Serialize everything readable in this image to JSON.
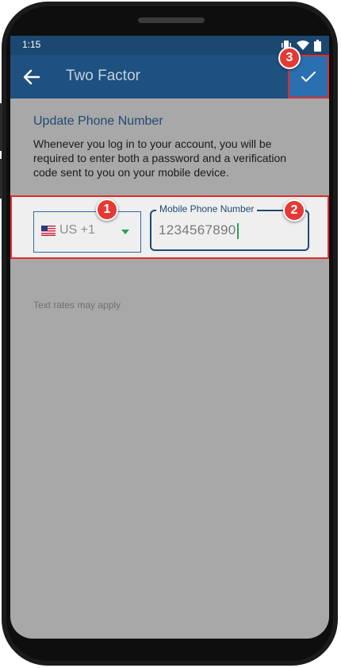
{
  "status_bar": {
    "time": "1:15",
    "icons": [
      "vibrate-icon",
      "wifi-icon",
      "battery-icon"
    ]
  },
  "app_bar": {
    "title": "Two Factor",
    "back_icon": "arrow-left-icon",
    "confirm_icon": "check-icon"
  },
  "content": {
    "section_title": "Update Phone Number",
    "description": "Whenever you log in to your account, you will be required to enter both a password and a verification code sent to you on your mobile device.",
    "country_select": {
      "flag": "🇺🇸",
      "value": "US +1"
    },
    "phone_field": {
      "label": "Mobile Phone Number",
      "value": "1234567890"
    },
    "note": "Text rates may apply"
  },
  "annotations": [
    "1",
    "2",
    "3"
  ],
  "colors": {
    "app_bar": "#1e5080",
    "status_bar": "#1c4770",
    "confirm_button": "#2a6fb0",
    "highlight": "#e02c2c",
    "badge": "#e53935",
    "accent_green": "#27a35a"
  }
}
